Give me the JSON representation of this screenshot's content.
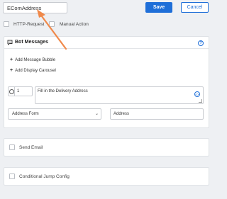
{
  "top": {
    "name_value": "EComAddress",
    "save_label": "Save",
    "cancel_label": "Cancel"
  },
  "options": {
    "http_request_label": "HTTP-Request",
    "manual_action_label": "Manual Action"
  },
  "bot_messages": {
    "title": "Bot Messages",
    "add_message_bubble": "Add Message Bubble",
    "add_display_carousel": "Add Display Carousel",
    "delay_value": "1",
    "message_text": "Fill in the Delivery Address",
    "select_value": "Address Form",
    "address_value": "Address"
  },
  "send_email": {
    "label": "Send Email"
  },
  "conditional_jump": {
    "label": "Conditional Jump Config"
  },
  "colors": {
    "accent": "#1f6fd8",
    "arrow": "#f0894a",
    "background": "#eef0f3"
  }
}
